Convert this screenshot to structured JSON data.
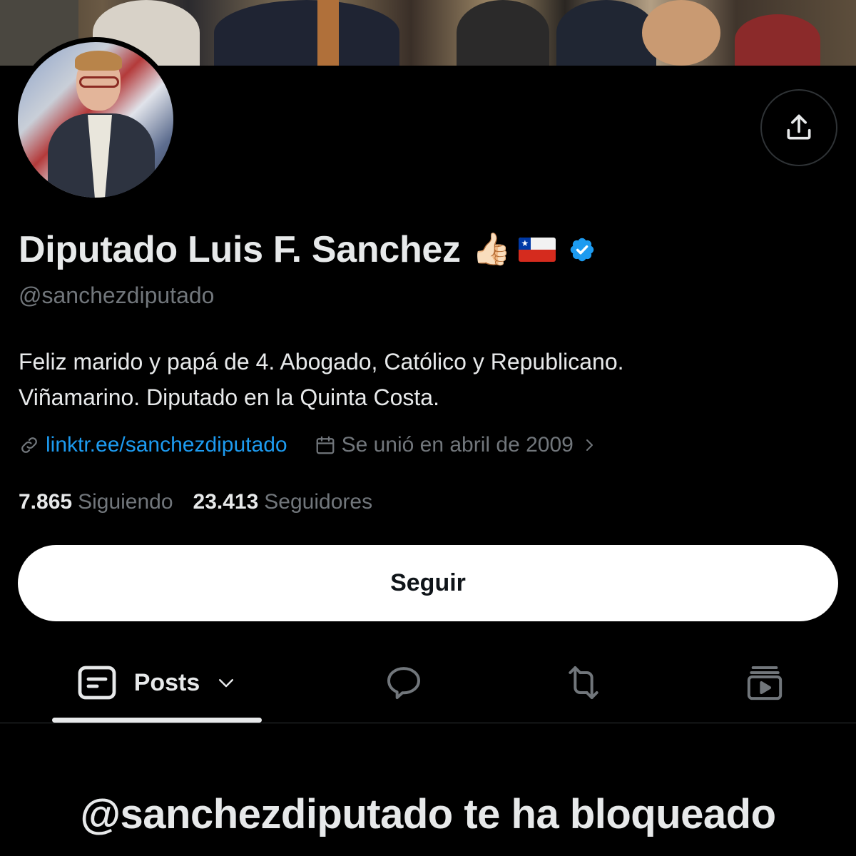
{
  "profile": {
    "display_name": "Diputado Luis F. Sanchez",
    "emoji": "👍🏻",
    "handle": "@sanchezdiputado",
    "bio_line1": "Feliz marido y papá de 4. Abogado, Católico y Republicano.",
    "bio_line2": "Viñamarino. Diputado en la Quinta Costa.",
    "link": "linktr.ee/sanchezdiputado",
    "joined": "Se unió en abril de 2009",
    "following_count": "7.865",
    "following_label": "Siguiendo",
    "followers_count": "23.413",
    "followers_label": "Seguidores"
  },
  "actions": {
    "follow_label": "Seguir",
    "share_icon": "share-icon"
  },
  "tabs": {
    "posts_label": "Posts",
    "items": [
      "posts",
      "replies",
      "reposts",
      "media"
    ]
  },
  "notice": {
    "blocked_text": "@sanchezdiputado te ha bloqueado"
  },
  "colors": {
    "background": "#000000",
    "link_blue": "#1d9bf0",
    "muted": "#71767b",
    "verified": "#1d9bf0"
  }
}
